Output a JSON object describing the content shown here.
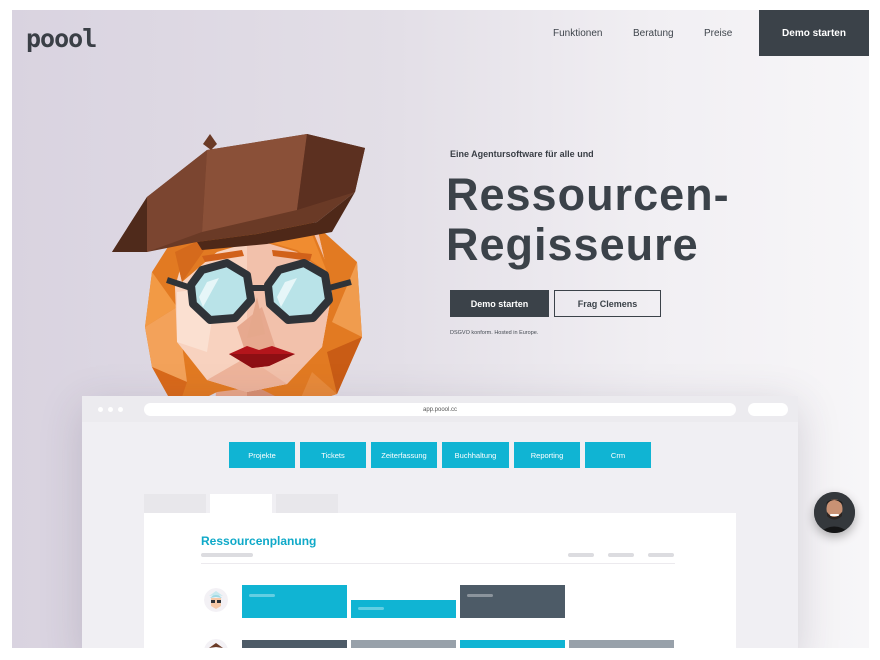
{
  "header": {
    "logo": "poool",
    "nav": [
      "Funktionen",
      "Beratung",
      "Preise"
    ],
    "cta": "Demo starten"
  },
  "hero": {
    "tagline": "Eine Agentursoftware für alle und",
    "headline_line1": "Ressourcen-",
    "headline_line2": "Regisseure",
    "primary_button": "Demo starten",
    "secondary_button": "Frag Clemens",
    "note": "DSGVO konform. Hosted in Europe."
  },
  "app": {
    "url": "app.poool.cc",
    "tabs": [
      "Projekte",
      "Tickets",
      "Zeiterfassung",
      "Buchhaltung",
      "Reporting",
      "Crm"
    ],
    "pane_title": "Ressourcenplanung"
  },
  "colors": {
    "accent": "#10b4d3",
    "dark": "#3b4249",
    "slate": "#4d5b67",
    "gray": "#98a1aa"
  },
  "icons": {
    "chat": "support-person-avatar",
    "character": "illustrated-woman-with-beret"
  }
}
